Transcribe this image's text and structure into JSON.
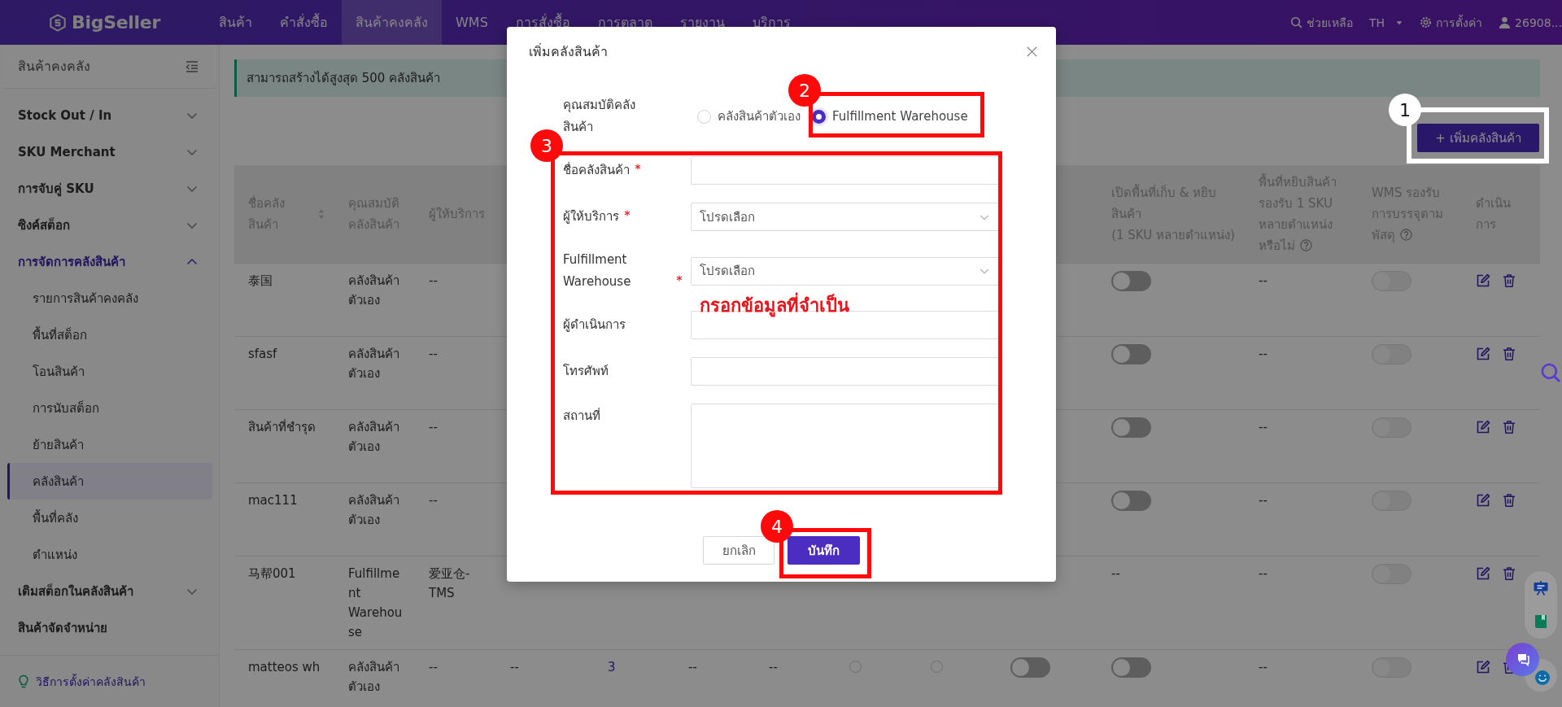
{
  "header": {
    "logo": "BigSeller",
    "nav": [
      {
        "label": "สินค้า",
        "selected": false
      },
      {
        "label": "คำสั่งซื้อ",
        "selected": false
      },
      {
        "label": "สินค้าคงคลัง",
        "selected": true
      },
      {
        "label": "WMS",
        "selected": false
      },
      {
        "label": "การสั่งซื้อ",
        "selected": false
      },
      {
        "label": "การตลาด",
        "selected": false
      },
      {
        "label": "รายงาน",
        "selected": false
      },
      {
        "label": "บริการ",
        "selected": false
      }
    ],
    "help": "ช่วยเหลือ",
    "language": "TH",
    "settings": "การตั้งค่า",
    "user": "26908..."
  },
  "sidebar": {
    "title": "สินค้าคงคลัง",
    "items": [
      {
        "label": "Stock Out / In",
        "kind": "group",
        "expanded": false
      },
      {
        "label": "SKU Merchant",
        "kind": "group",
        "expanded": false
      },
      {
        "label": "การจับคู่ SKU",
        "kind": "group",
        "expanded": false
      },
      {
        "label": "ซิงค์สต็อก",
        "kind": "group",
        "expanded": false
      },
      {
        "label": "การจัดการคลังสินค้า",
        "kind": "group",
        "expanded": true,
        "children": [
          {
            "label": "รายการสินค้าคงคลัง",
            "selected": false
          },
          {
            "label": "พื้นที่สต็อก",
            "selected": false
          },
          {
            "label": "โอนสินค้า",
            "selected": false
          },
          {
            "label": "การนับสต็อก",
            "selected": false
          },
          {
            "label": "ย้ายสินค้า",
            "selected": false
          },
          {
            "label": "คลังสินค้า",
            "selected": true
          },
          {
            "label": "พื้นที่คลัง",
            "selected": false
          },
          {
            "label": "ตำแหน่ง",
            "selected": false
          }
        ]
      },
      {
        "label": "เติมสต็อกในคลังสินค้า",
        "kind": "group",
        "expanded": false
      },
      {
        "label": "สินค้าจัดจำหน่าย",
        "kind": "link"
      }
    ],
    "help_link": "วิธีการตั้งค่าคลังสินค้า"
  },
  "notice": "สามารถสร้างได้สูงสุด 500 คลังสินค้า",
  "add_button": "+ เพิ่มคลังสินค้า",
  "table": {
    "columns": [
      {
        "label": "ชื่อคลังสินค้า",
        "sortable": true
      },
      {
        "label": "คุณสมบัติคลังสินค้า"
      },
      {
        "label": "ผู้ให้บริการ"
      },
      {},
      {},
      {},
      {},
      {},
      {},
      {},
      {
        "label": "เปิดพื้นที่เก็บ & หยิบสินค้า",
        "note": "(1 SKU หลายตำแหน่ง)"
      },
      {
        "label": "พื้นที่หยิบสินค้ารองรับ 1 SKU หลายตำแหน่งหรือไม่",
        "help": true
      },
      {
        "label": "WMS รองรับการบรรจุตามพัสดุ",
        "help": true
      },
      {
        "label": "ดำเนินการ"
      }
    ],
    "rows": [
      {
        "cells": [
          {
            "kind": "text",
            "text": "泰国"
          },
          {
            "kind": "text",
            "text": "คลังสินค้าตัวเอง"
          },
          {
            "kind": "text",
            "text": "--"
          },
          null,
          null,
          null,
          null,
          null,
          null,
          null,
          {
            "kind": "toggle",
            "on": false,
            "disabled": false
          },
          {
            "kind": "text",
            "text": "--"
          },
          {
            "kind": "toggle",
            "on": false,
            "disabled": true
          },
          {
            "kind": "actions"
          }
        ]
      },
      {
        "cells": [
          {
            "kind": "text",
            "text": "sfasf"
          },
          {
            "kind": "text",
            "text": "คลังสินค้าตัวเอง"
          },
          {
            "kind": "text",
            "text": "--"
          },
          null,
          null,
          null,
          null,
          null,
          null,
          null,
          {
            "kind": "toggle",
            "on": false,
            "disabled": false
          },
          {
            "kind": "text",
            "text": "--"
          },
          {
            "kind": "toggle",
            "on": false,
            "disabled": true
          },
          {
            "kind": "actions"
          }
        ]
      },
      {
        "cells": [
          {
            "kind": "text",
            "text": "สินค้าที่ชำรุด"
          },
          {
            "kind": "text",
            "text": "คลังสินค้าตัวเอง"
          },
          {
            "kind": "text",
            "text": "--"
          },
          null,
          null,
          null,
          null,
          null,
          null,
          null,
          {
            "kind": "toggle",
            "on": false,
            "disabled": false
          },
          {
            "kind": "text",
            "text": "--"
          },
          {
            "kind": "toggle",
            "on": false,
            "disabled": true
          },
          {
            "kind": "actions"
          }
        ]
      },
      {
        "cells": [
          {
            "kind": "text",
            "text": "mac111"
          },
          {
            "kind": "text",
            "text": "คลังสินค้าตัวเอง"
          },
          {
            "kind": "text",
            "text": "--"
          },
          null,
          null,
          null,
          null,
          null,
          null,
          null,
          {
            "kind": "toggle",
            "on": false,
            "disabled": false
          },
          {
            "kind": "text",
            "text": "--"
          },
          {
            "kind": "toggle",
            "on": false,
            "disabled": true
          },
          {
            "kind": "actions"
          }
        ]
      },
      {
        "cells": [
          {
            "kind": "text",
            "text": "马帮001"
          },
          {
            "kind": "text",
            "text": "Fulfillment Warehouse"
          },
          {
            "kind": "text",
            "text": "爱亚仓-TMS"
          },
          null,
          null,
          null,
          null,
          null,
          null,
          null,
          {
            "kind": "text",
            "text": "--"
          },
          {
            "kind": "text",
            "text": "--"
          },
          {
            "kind": "toggle",
            "on": false,
            "disabled": true
          },
          {
            "kind": "actions"
          }
        ]
      },
      {
        "cells": [
          {
            "kind": "text",
            "text": "matteos wh"
          },
          {
            "kind": "text",
            "text": "คลังสินค้าตัวเอง"
          },
          {
            "kind": "text",
            "text": "--"
          },
          {
            "kind": "text",
            "text": "--"
          },
          {
            "kind": "link",
            "text": "3"
          },
          {
            "kind": "text",
            "text": "--"
          },
          {
            "kind": "text",
            "text": "--"
          },
          {
            "kind": "radio",
            "checked": false
          },
          {
            "kind": "radio",
            "checked": false
          },
          {
            "kind": "toggle",
            "on": false,
            "disabled": false
          },
          {
            "kind": "toggle",
            "on": false,
            "disabled": false
          },
          {
            "kind": "text",
            "text": "--"
          },
          {
            "kind": "toggle",
            "on": false,
            "disabled": true
          },
          {
            "kind": "actions"
          }
        ]
      }
    ]
  },
  "dialog": {
    "title": "เพิ่มคลังสินค้า",
    "property": {
      "label": "คุณสมบัติคลังสินค้า",
      "options": [
        {
          "label": "คลังสินค้าตัวเอง",
          "selected": false
        },
        {
          "label": "Fulfillment Warehouse",
          "selected": true
        }
      ]
    },
    "fields": [
      {
        "kind": "input",
        "label": "ชื่อคลังสินค้า",
        "required": true
      },
      {
        "kind": "select",
        "label": "ผู้ให้บริการ",
        "required": true,
        "placeholder": "โปรดเลือก"
      },
      {
        "kind": "select",
        "label": "Fulfillment Warehouse",
        "required": true,
        "placeholder": "โปรดเลือก"
      },
      {
        "kind": "input",
        "label": "ผู้ดำเนินการ",
        "required": false
      },
      {
        "kind": "input",
        "label": "โทรศัพท์",
        "required": false
      },
      {
        "kind": "textarea",
        "label": "สถานที่",
        "required": false
      }
    ],
    "buttons": [
      {
        "label": "ยกเลิก",
        "kind": "secondary"
      },
      {
        "label": "บันทึก",
        "kind": "primary"
      }
    ]
  },
  "annotations": [
    {
      "label": "1",
      "color": "#ffffff"
    },
    {
      "label": "2",
      "color": "#ff0a0a"
    },
    {
      "label": "3",
      "color": "#ff0a0a"
    },
    {
      "label": "4",
      "color": "#ff0a0a"
    }
  ],
  "annotation_note": "กรอกข้อมูลที่จำเป็น"
}
